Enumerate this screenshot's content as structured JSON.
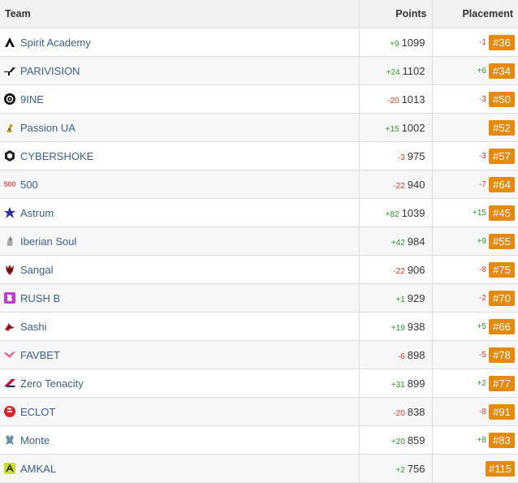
{
  "header": {
    "team": "Team",
    "points": "Points",
    "placement": "Placement"
  },
  "rows": [
    {
      "team": "Spirit Academy",
      "icon": "spirit-icon",
      "points_delta": "+9",
      "points": "1099",
      "place_delta": "-1",
      "place": "#36"
    },
    {
      "team": "PARIVISION",
      "icon": "parivision-icon",
      "points_delta": "+24",
      "points": "1102",
      "place_delta": "+6",
      "place": "#34"
    },
    {
      "team": "9INE",
      "icon": "9ine-icon",
      "points_delta": "-20",
      "points": "1013",
      "place_delta": "-3",
      "place": "#50"
    },
    {
      "team": "Passion UA",
      "icon": "passion-icon",
      "points_delta": "+15",
      "points": "1002",
      "place_delta": "",
      "place": "#52"
    },
    {
      "team": "CYBERSHOKE",
      "icon": "cybershoke-icon",
      "points_delta": "-3",
      "points": "975",
      "place_delta": "-3",
      "place": "#57"
    },
    {
      "team": "500",
      "icon": "500-icon",
      "logo_text": "500",
      "points_delta": "-22",
      "points": "940",
      "place_delta": "-7",
      "place": "#64"
    },
    {
      "team": "Astrum",
      "icon": "astrum-icon",
      "points_delta": "+82",
      "points": "1039",
      "place_delta": "+15",
      "place": "#45"
    },
    {
      "team": "Iberian Soul",
      "icon": "iberian-soul-icon",
      "points_delta": "+42",
      "points": "984",
      "place_delta": "+9",
      "place": "#55"
    },
    {
      "team": "Sangal",
      "icon": "sangal-icon",
      "points_delta": "-22",
      "points": "906",
      "place_delta": "-8",
      "place": "#75"
    },
    {
      "team": "RUSH B",
      "icon": "rush-b-icon",
      "points_delta": "+1",
      "points": "929",
      "place_delta": "-2",
      "place": "#70"
    },
    {
      "team": "Sashi",
      "icon": "sashi-icon",
      "points_delta": "+19",
      "points": "938",
      "place_delta": "+5",
      "place": "#66"
    },
    {
      "team": "FAVBET",
      "icon": "favbet-icon",
      "points_delta": "-6",
      "points": "898",
      "place_delta": "-5",
      "place": "#78"
    },
    {
      "team": "Zero Tenacity",
      "icon": "zero-tenacity-icon",
      "points_delta": "+31",
      "points": "899",
      "place_delta": "+2",
      "place": "#77"
    },
    {
      "team": "ECLOT",
      "icon": "eclot-icon",
      "points_delta": "-20",
      "points": "838",
      "place_delta": "-8",
      "place": "#91"
    },
    {
      "team": "Monte",
      "icon": "monte-icon",
      "points_delta": "+20",
      "points": "859",
      "place_delta": "+8",
      "place": "#83"
    },
    {
      "team": "AMKAL",
      "icon": "amkal-icon",
      "points_delta": "+2",
      "points": "756",
      "place_delta": "",
      "place": "#115"
    }
  ],
  "colors": {
    "badge": "#e48a0f",
    "positive": "#2a9a2a",
    "negative": "#d43a2a",
    "link": "#3a5c8c"
  }
}
